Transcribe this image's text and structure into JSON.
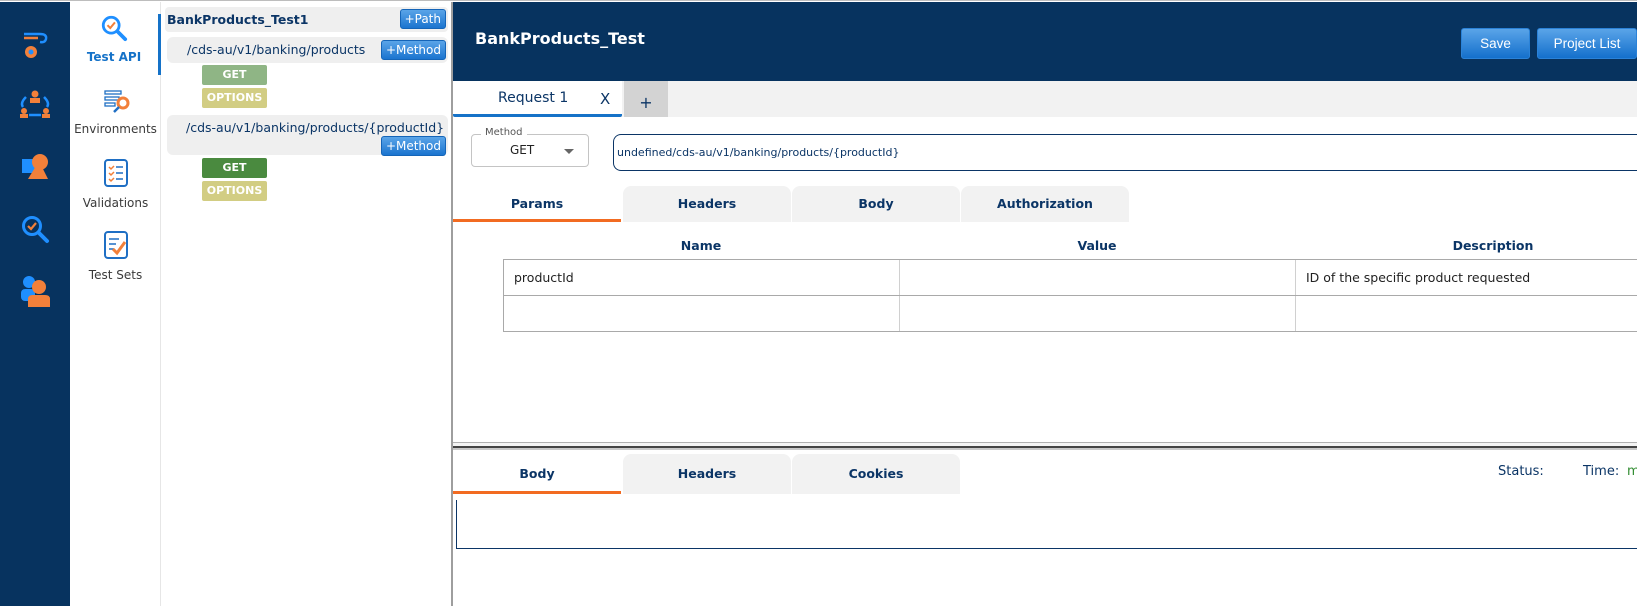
{
  "app": {
    "project_title": "BankProducts_Test",
    "save_label": "Save",
    "project_list_label": "Project List"
  },
  "iconbar": {
    "items": [
      {
        "icon": "workflow-gear-icon"
      },
      {
        "icon": "team-cycle-icon"
      },
      {
        "icon": "shapes-icon"
      },
      {
        "icon": "search-check-icon"
      },
      {
        "icon": "users-icon"
      }
    ]
  },
  "sidenav": {
    "items": [
      {
        "label": "Test API",
        "icon": "search-check-icon",
        "active": true
      },
      {
        "label": "Environments",
        "icon": "settings-list-icon",
        "active": false
      },
      {
        "label": "Validations",
        "icon": "checklist-icon",
        "active": false
      },
      {
        "label": "Test Sets",
        "icon": "checked-doc-icon",
        "active": false
      }
    ]
  },
  "tree": {
    "project_name": "BankProducts_Test1",
    "add_path_label": "+Path",
    "paths": [
      {
        "path": "/cds-au/v1/banking/products",
        "add_method_label": "+Method",
        "methods": [
          {
            "label": "GET",
            "color": "#8fb585"
          },
          {
            "label": "OPTIONS",
            "color": "#d2cd83"
          }
        ]
      },
      {
        "path": "/cds-au/v1/banking/products/{productId}",
        "add_method_label": "+Method",
        "methods": [
          {
            "label": "GET",
            "color": "#4a8a3f"
          },
          {
            "label": "OPTIONS",
            "color": "#d2cd83"
          }
        ]
      }
    ]
  },
  "request": {
    "tabs": [
      {
        "label": "Request 1",
        "close": "X"
      }
    ],
    "add_tab_label": "+",
    "method_legend": "Method",
    "method_value": "GET",
    "url": "undefined/cds-au/v1/banking/products/{productId}",
    "param_tabs": [
      "Params",
      "Headers",
      "Body",
      "Authorization"
    ],
    "active_param_tab": "Params",
    "params_table": {
      "columns": [
        "Name",
        "Value",
        "Description"
      ],
      "rows": [
        {
          "name": "productId",
          "value": "",
          "description": "ID of the specific product requested"
        },
        {
          "name": "",
          "value": "",
          "description": ""
        }
      ]
    }
  },
  "response": {
    "tabs": [
      "Body",
      "Headers",
      "Cookies"
    ],
    "active_tab": "Body",
    "status_label": "Status:",
    "status_value": "",
    "time_label": "Time:",
    "time_value": "ms"
  },
  "colors": {
    "navy": "#07335f",
    "accent_blue": "#1572c8",
    "accent_orange": "#f26b21"
  }
}
